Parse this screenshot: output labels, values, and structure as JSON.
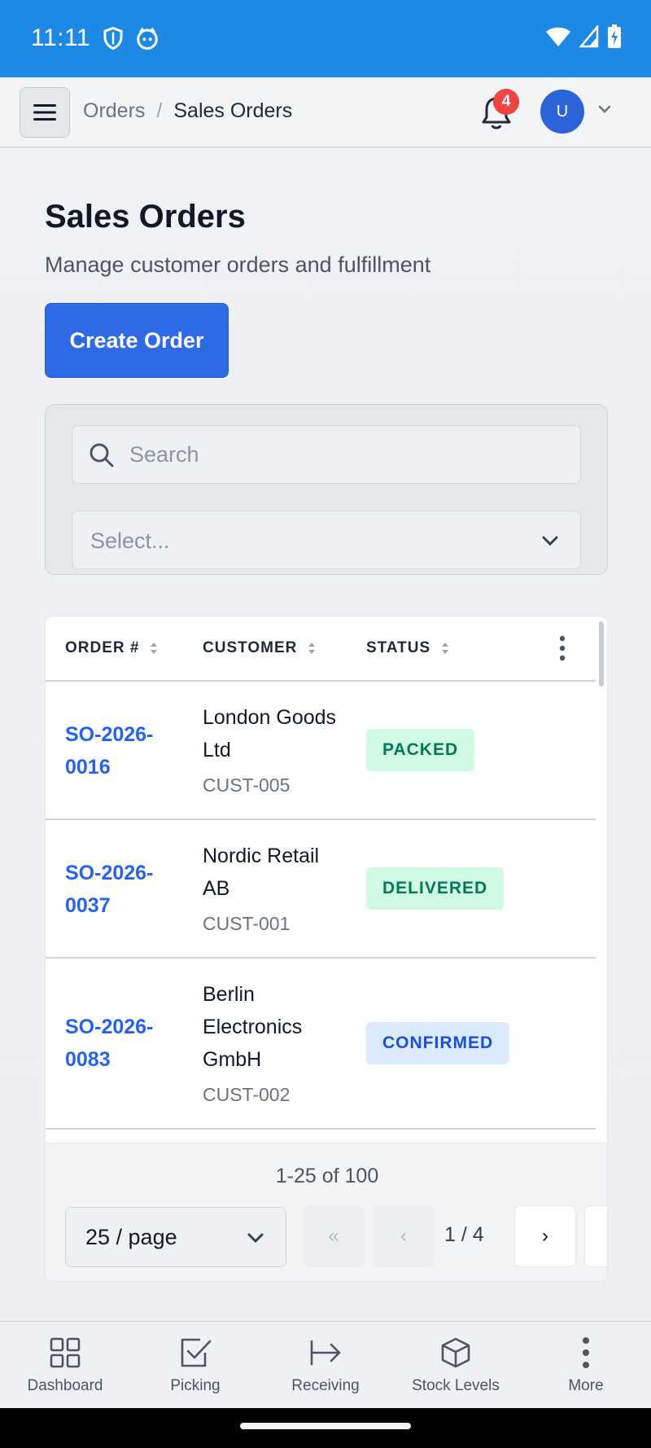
{
  "status_bar": {
    "time": "11:11"
  },
  "header": {
    "breadcrumb_parent": "Orders",
    "breadcrumb_separator": "/",
    "breadcrumb_current": "Sales Orders",
    "notification_count": "4",
    "avatar_initial": "U"
  },
  "page": {
    "title": "Sales Orders",
    "subtitle": "Manage customer orders and fulfillment",
    "create_button": "Create Order"
  },
  "filters": {
    "search_placeholder": "Search",
    "select_placeholder": "Select..."
  },
  "table": {
    "columns": [
      "ORDER #",
      "CUSTOMER",
      "STATUS"
    ],
    "rows": [
      {
        "order": "SO-2026-0016",
        "customer": "London Goods Ltd",
        "customer_id": "CUST-005",
        "status": "PACKED"
      },
      {
        "order": "SO-2026-0037",
        "customer": "Nordic Retail AB",
        "customer_id": "CUST-001",
        "status": "DELIVERED"
      },
      {
        "order": "SO-2026-0083",
        "customer": "Berlin Electronics GmbH",
        "customer_id": "CUST-002",
        "status": "CONFIRMED"
      }
    ]
  },
  "pagination": {
    "summary": "1-25 of 100",
    "page_size": "25 / page",
    "first": "«",
    "prev": "‹",
    "indicator": "1 / 4",
    "next": "›"
  },
  "bottom_nav": {
    "items": [
      {
        "label": "Dashboard",
        "icon": "grid-icon"
      },
      {
        "label": "Picking",
        "icon": "checkbox-icon"
      },
      {
        "label": "Receiving",
        "icon": "arrow-right-bar-icon"
      },
      {
        "label": "Stock Levels",
        "icon": "box-icon"
      },
      {
        "label": "More",
        "icon": "more-vertical-icon"
      }
    ]
  },
  "colors": {
    "status_bar": "#1e88e5",
    "primary": "#2f6ae6",
    "link": "#2563eb",
    "badge": "#ef4444",
    "status_green_bg": "#d1fae5",
    "status_green_text": "#047857",
    "status_blue_bg": "#dbeafe",
    "status_blue_text": "#1d4ed8"
  }
}
